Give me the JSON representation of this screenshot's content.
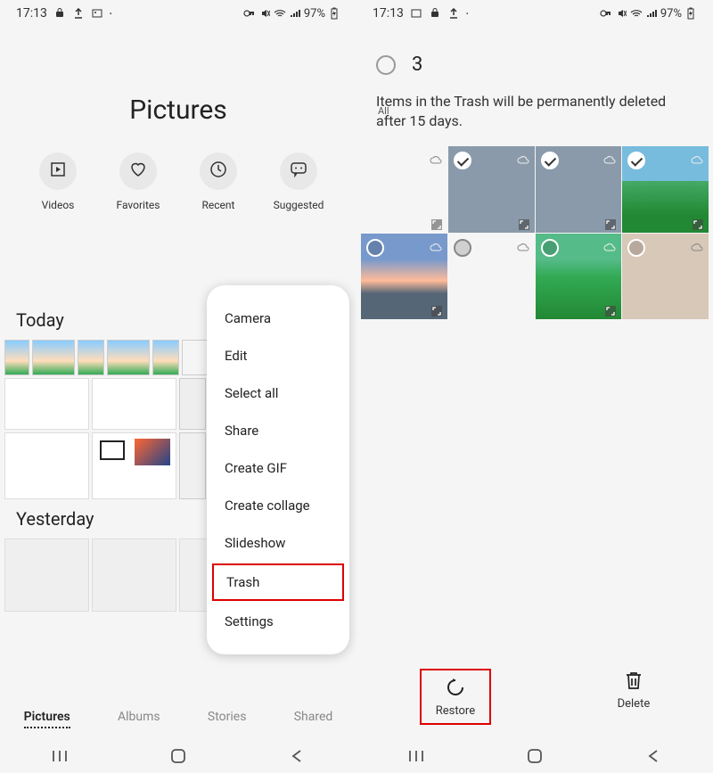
{
  "left": {
    "status": {
      "time": "17:13",
      "battery": "97%"
    },
    "title": "Pictures",
    "actions": [
      {
        "label": "Videos",
        "icon": "play"
      },
      {
        "label": "Favorites",
        "icon": "heart"
      },
      {
        "label": "Recent",
        "icon": "clock"
      },
      {
        "label": "Suggested",
        "icon": "chat"
      }
    ],
    "sections": [
      {
        "header": "Today"
      },
      {
        "header": "Yesterday"
      }
    ],
    "menu": {
      "items": [
        "Camera",
        "Edit",
        "Select all",
        "Share",
        "Create GIF",
        "Create collage",
        "Slideshow",
        "Trash",
        "Settings"
      ],
      "highlighted": "Trash"
    },
    "tabs": [
      "Pictures",
      "Albums",
      "Stories",
      "Shared"
    ],
    "active_tab": "Pictures"
  },
  "right": {
    "status": {
      "time": "17:13",
      "battery": "97%"
    },
    "selection": {
      "count": "3",
      "all_label": "All"
    },
    "message": "Items in the Trash will be permanently deleted after 15 days.",
    "cells": [
      {
        "checked": false
      },
      {
        "checked": true
      },
      {
        "checked": true
      },
      {
        "checked": true
      },
      {
        "checked": false
      },
      {
        "checked": false
      },
      {
        "checked": false
      },
      {
        "checked": false
      }
    ],
    "actions": [
      {
        "label": "Restore",
        "hl": true
      },
      {
        "label": "Delete",
        "hl": false
      }
    ]
  }
}
